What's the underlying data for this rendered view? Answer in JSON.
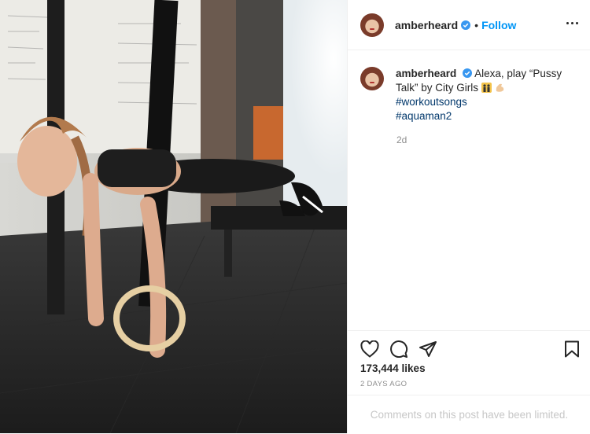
{
  "post": {
    "username": "amberheard",
    "follow_label": "Follow",
    "separator": "•",
    "caption": {
      "username": "amberheard",
      "text_before": "Alexa, play “Pussy Talk” by City Girls",
      "hashtags": [
        "#workoutsongs",
        "#aquaman2"
      ],
      "relative_time": "2d"
    },
    "likes_label": "173,444 likes",
    "posted_ago": "2 DAYS AGO",
    "comments_notice": "Comments on this post have been limited.",
    "icons": {
      "verified": "verified-badge-icon",
      "more": "more-options-icon",
      "like": "heart-icon",
      "comment": "comment-icon",
      "share": "share-icon",
      "save": "bookmark-icon",
      "emoji_1": "dancers-emoji-icon",
      "emoji_2": "flexed-biceps-emoji-icon"
    },
    "colors": {
      "accent": "#0095f6",
      "hashtag": "#00376b",
      "muted": "#8e8e8e"
    }
  }
}
